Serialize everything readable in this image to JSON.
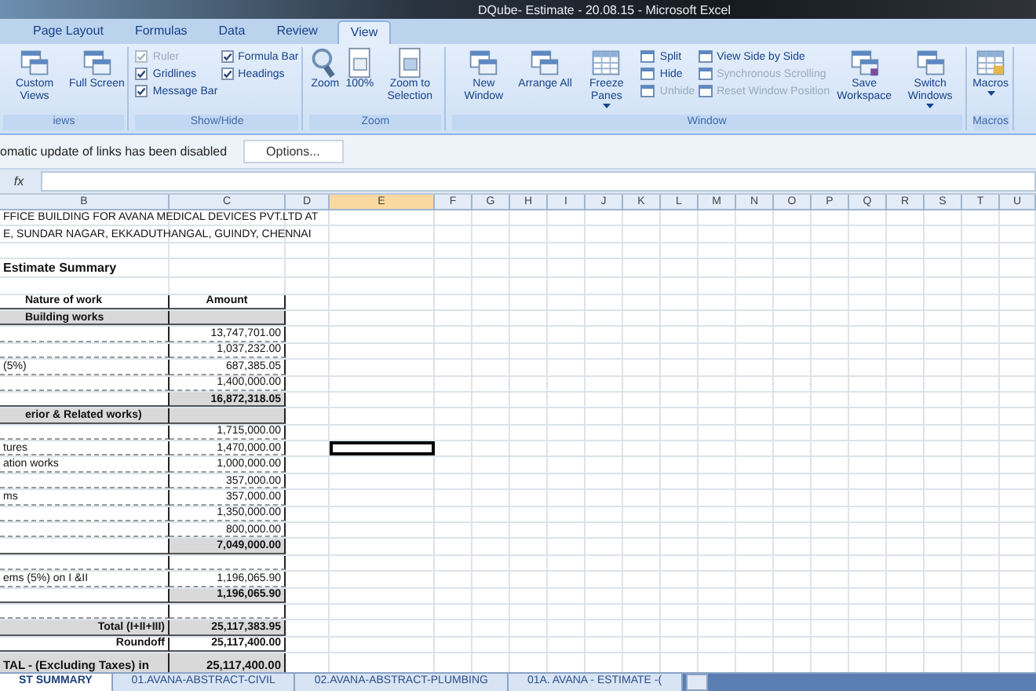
{
  "window": {
    "title": "DQube- Estimate - 20.08.15 - Microsoft Excel"
  },
  "ribbon_tabs": [
    {
      "label": "Page Layout",
      "selected": false
    },
    {
      "label": "Formulas",
      "selected": false
    },
    {
      "label": "Data",
      "selected": false
    },
    {
      "label": "Review",
      "selected": false
    },
    {
      "label": "View",
      "selected": true
    }
  ],
  "ribbon_groups": [
    {
      "label": "iews",
      "items": [
        {
          "kind": "large",
          "label": "Custom Views"
        },
        {
          "kind": "large",
          "label": "Full Screen"
        }
      ]
    },
    {
      "label": "Show/Hide",
      "items": [
        {
          "kind": "check",
          "label": "Ruler",
          "checked": true,
          "disabled": true
        },
        {
          "kind": "check",
          "label": "Gridlines",
          "checked": true,
          "disabled": false
        },
        {
          "kind": "check",
          "label": "Message Bar",
          "checked": true,
          "disabled": false
        },
        {
          "kind": "check",
          "label": "Formula Bar",
          "checked": true,
          "disabled": false
        },
        {
          "kind": "check",
          "label": "Headings",
          "checked": true,
          "disabled": false
        }
      ]
    },
    {
      "label": "Zoom",
      "items": [
        {
          "kind": "large",
          "label": "Zoom"
        },
        {
          "kind": "large",
          "label": "100%"
        },
        {
          "kind": "large",
          "label": "Zoom to Selection"
        }
      ]
    },
    {
      "label": "Window",
      "items": [
        {
          "kind": "large",
          "label": "New Window"
        },
        {
          "kind": "large",
          "label": "Arrange All"
        },
        {
          "kind": "large",
          "label": "Freeze Panes",
          "dropdown": true
        },
        {
          "kind": "small",
          "label": "Split",
          "disabled": false
        },
        {
          "kind": "small",
          "label": "Hide",
          "disabled": false
        },
        {
          "kind": "small",
          "label": "Unhide",
          "disabled": true
        },
        {
          "kind": "small",
          "label": "View Side by Side",
          "disabled": false
        },
        {
          "kind": "small",
          "label": "Synchronous Scrolling",
          "disabled": true
        },
        {
          "kind": "small",
          "label": "Reset Window Position",
          "disabled": true
        },
        {
          "kind": "large",
          "label": "Save Workspace"
        },
        {
          "kind": "large",
          "label": "Switch Windows",
          "dropdown": true
        }
      ]
    },
    {
      "label": "Macros",
      "items": [
        {
          "kind": "large",
          "label": "Macros",
          "dropdown": true
        }
      ]
    }
  ],
  "message_bar": {
    "text": "omatic update of links has been disabled",
    "button": "Options..."
  },
  "formula_bar": {
    "fx": "fx"
  },
  "columns": [
    {
      "label": "B",
      "selected": false
    },
    {
      "label": "C",
      "selected": false
    },
    {
      "label": "D",
      "selected": false
    },
    {
      "label": "E",
      "selected": true
    },
    {
      "label": "F",
      "selected": false
    },
    {
      "label": "G",
      "selected": false
    },
    {
      "label": "H",
      "selected": false
    },
    {
      "label": "I",
      "selected": false
    },
    {
      "label": "J",
      "selected": false
    },
    {
      "label": "K",
      "selected": false
    },
    {
      "label": "L",
      "selected": false
    },
    {
      "label": "M",
      "selected": false
    },
    {
      "label": "N",
      "selected": false
    },
    {
      "label": "O",
      "selected": false
    },
    {
      "label": "P",
      "selected": false
    },
    {
      "label": "Q",
      "selected": false
    },
    {
      "label": "R",
      "selected": false
    },
    {
      "label": "S",
      "selected": false
    },
    {
      "label": "T",
      "selected": false
    },
    {
      "label": "U",
      "selected": false
    }
  ],
  "rows": [
    {
      "kind": "title",
      "b": "FFICE BUILDING FOR AVANA MEDICAL DEVICES PVT.LTD AT",
      "c": "",
      "selected": false
    },
    {
      "kind": "title",
      "b": "E, SUNDAR NAGAR, EKKADUTHANGAL, GUINDY, CHENNAI",
      "c": "",
      "selected": false
    },
    {
      "kind": "blank",
      "b": "",
      "c": "",
      "selected": false
    },
    {
      "kind": "heading",
      "b": "Estimate Summary",
      "c": "",
      "selected": false
    },
    {
      "kind": "blank",
      "b": "",
      "c": "",
      "selected": false
    },
    {
      "kind": "header",
      "b": "Nature of work",
      "c": "Amount",
      "selected": false
    },
    {
      "kind": "section",
      "b": "Building works",
      "c": "",
      "selected": false
    },
    {
      "kind": "item",
      "b": "",
      "c": "13,747,701.00",
      "selected": false
    },
    {
      "kind": "item",
      "b": "",
      "c": "1,037,232.00",
      "selected": false
    },
    {
      "kind": "item",
      "b": "(5%)",
      "c": "687,385.05",
      "selected": false
    },
    {
      "kind": "item",
      "b": "",
      "c": "1,400,000.00",
      "selected": false
    },
    {
      "kind": "subtotal",
      "b": "",
      "c": "16,872,318.05",
      "selected": false
    },
    {
      "kind": "section",
      "b": "erior & Related works)",
      "c": "",
      "selected": false
    },
    {
      "kind": "item",
      "b": "",
      "c": "1,715,000.00",
      "selected": false
    },
    {
      "kind": "item",
      "b": "tures",
      "c": "1,470,000.00",
      "selected": true
    },
    {
      "kind": "item",
      "b": "ation works",
      "c": "1,000,000.00",
      "selected": false
    },
    {
      "kind": "item",
      "b": "",
      "c": "357,000.00",
      "selected": false
    },
    {
      "kind": "item",
      "b": "ms",
      "c": "357,000.00",
      "selected": false
    },
    {
      "kind": "item",
      "b": "",
      "c": "1,350,000.00",
      "selected": false
    },
    {
      "kind": "item",
      "b": "",
      "c": "800,000.00",
      "selected": false
    },
    {
      "kind": "subtotal",
      "b": "",
      "c": "7,049,000.00",
      "selected": false
    },
    {
      "kind": "itemblank",
      "b": "",
      "c": "",
      "selected": false
    },
    {
      "kind": "item",
      "b": "ems (5%) on I &II",
      "c": "1,196,065.90",
      "selected": false
    },
    {
      "kind": "subtotal",
      "b": "",
      "c": "1,196,065.90",
      "selected": false
    },
    {
      "kind": "itemblank",
      "b": "",
      "c": "",
      "selected": false
    },
    {
      "kind": "total",
      "b": "Total (I+II+III)",
      "c": "25,117,383.95",
      "selected": false
    },
    {
      "kind": "roundoff",
      "b": "Roundoff",
      "c": "25,117,400.00",
      "selected": false
    },
    {
      "kind": "grand",
      "b": "TAL - (Excluding Taxes) in",
      "c": "25,117,400.00",
      "selected": false
    }
  ],
  "sheet_tabs": [
    {
      "label": "ST SUMMARY",
      "selected": true
    },
    {
      "label": "01.AVANA-ABSTRACT-CIVIL",
      "selected": false
    },
    {
      "label": "02.AVANA-ABSTRACT-PLUMBING",
      "selected": false
    },
    {
      "label": "01A. AVANA - ESTIMATE -(",
      "selected": false
    }
  ]
}
